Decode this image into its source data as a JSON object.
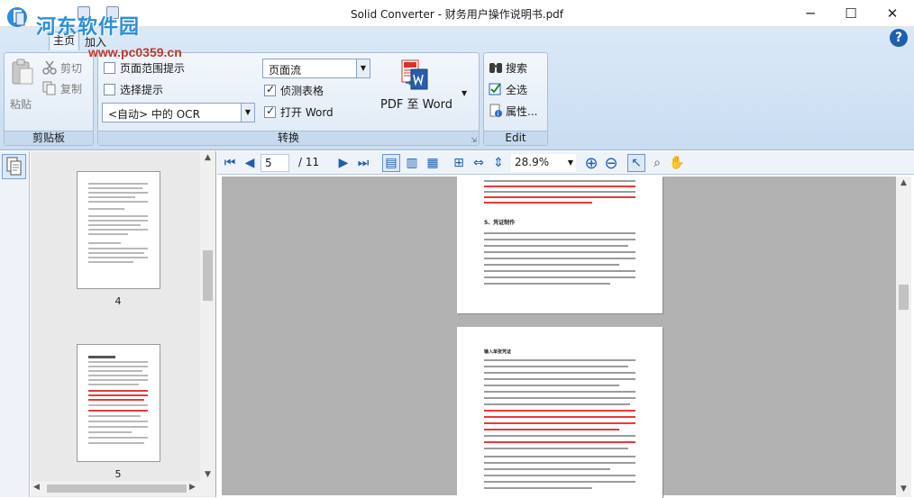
{
  "window": {
    "title": "Solid Converter - 财务用户操作说明书.pdf",
    "minimize": "─",
    "maximize": "☐",
    "close": "✕"
  },
  "watermark": {
    "site": "河东软件园",
    "url": "www.pc0359.cn"
  },
  "ribbon": {
    "tabs": [
      "主页",
      "加入"
    ],
    "help": "?",
    "clipboard": {
      "paste": "粘贴",
      "cut": "剪切",
      "copy": "复制",
      "group_label": "剪贴板"
    },
    "convert": {
      "page_range_hint": "页面范围提示",
      "page_range_hint_checked": false,
      "selection_hint": "选择提示",
      "selection_hint_checked": false,
      "ocr_value": "<自动> 中的 OCR",
      "layout_value": "页面流",
      "detect_tables": "侦测表格",
      "detect_tables_checked": true,
      "open_word": "打开 Word",
      "open_word_checked": true,
      "pdf_to_word": "PDF 至 Word",
      "group_label": "转换"
    },
    "edit": {
      "search": "搜索",
      "select_all": "全选",
      "properties": "属性...",
      "group_label": "Edit"
    }
  },
  "thumbnails": {
    "pages": [
      "4",
      "5"
    ]
  },
  "navbar": {
    "current_page": "5",
    "total_pages": "/ 11",
    "zoom": "28.9%"
  },
  "document": {
    "heading": "5、凭证制作",
    "subheading": "输入单张凭证"
  },
  "colors": {
    "accent": "#1f5fb0",
    "highlight_text": "#e83a3a"
  }
}
